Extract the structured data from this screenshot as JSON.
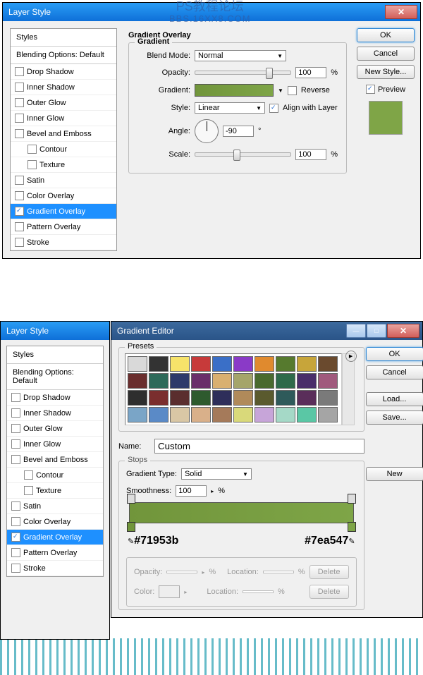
{
  "watermark": {
    "line1": "PS教程论坛",
    "line2": "BBS.16XX8.COM"
  },
  "dialog1": {
    "title": "Layer Style",
    "styles_header": "Styles",
    "blending_opts": "Blending Options: Default",
    "items": [
      {
        "label": "Drop Shadow",
        "checked": false,
        "indent": false
      },
      {
        "label": "Inner Shadow",
        "checked": false,
        "indent": false
      },
      {
        "label": "Outer Glow",
        "checked": false,
        "indent": false
      },
      {
        "label": "Inner Glow",
        "checked": false,
        "indent": false
      },
      {
        "label": "Bevel and Emboss",
        "checked": false,
        "indent": false
      },
      {
        "label": "Contour",
        "checked": false,
        "indent": true
      },
      {
        "label": "Texture",
        "checked": false,
        "indent": true
      },
      {
        "label": "Satin",
        "checked": false,
        "indent": false
      },
      {
        "label": "Color Overlay",
        "checked": false,
        "indent": false
      },
      {
        "label": "Gradient Overlay",
        "checked": true,
        "indent": false,
        "active": true
      },
      {
        "label": "Pattern Overlay",
        "checked": false,
        "indent": false
      },
      {
        "label": "Stroke",
        "checked": false,
        "indent": false
      }
    ],
    "center": {
      "heading": "Gradient Overlay",
      "group": "Gradient",
      "blend_mode_lbl": "Blend Mode:",
      "blend_mode_val": "Normal",
      "opacity_lbl": "Opacity:",
      "opacity_val": "100",
      "pct": "%",
      "gradient_lbl": "Gradient:",
      "reverse_lbl": "Reverse",
      "style_lbl": "Style:",
      "style_val": "Linear",
      "align_lbl": "Align with Layer",
      "angle_lbl": "Angle:",
      "angle_val": "-90",
      "deg": "°",
      "scale_lbl": "Scale:",
      "scale_val": "100"
    },
    "buttons": {
      "ok": "OK",
      "cancel": "Cancel",
      "new_style": "New Style...",
      "preview": "Preview"
    }
  },
  "dialog2": {
    "title": "Layer Style",
    "styles_header": "Styles",
    "blending_opts": "Blending Options: Default",
    "items": [
      {
        "label": "Drop Shadow",
        "checked": false
      },
      {
        "label": "Inner Shadow",
        "checked": false
      },
      {
        "label": "Outer Glow",
        "checked": false
      },
      {
        "label": "Inner Glow",
        "checked": false
      },
      {
        "label": "Bevel and Emboss",
        "checked": false
      },
      {
        "label": "Contour",
        "checked": false,
        "indent": true
      },
      {
        "label": "Texture",
        "checked": false,
        "indent": true
      },
      {
        "label": "Satin",
        "checked": false
      },
      {
        "label": "Color Overlay",
        "checked": false
      },
      {
        "label": "Gradient Overlay",
        "checked": true,
        "active": true
      },
      {
        "label": "Pattern Overlay",
        "checked": false
      },
      {
        "label": "Stroke",
        "checked": false
      }
    ]
  },
  "grad_editor": {
    "title": "Gradient Editor",
    "presets_lbl": "Presets",
    "swatches": [
      "#d9d9d9",
      "#333333",
      "#f7e36a",
      "#c73a3a",
      "#3a6fc7",
      "#8a3ac7",
      "#e08a2e",
      "#567a2e",
      "#c7a53a",
      "#6a4a2e",
      "#6a2e2e",
      "#2e6a5a",
      "#2e3a6a",
      "#6a2e6a",
      "#d9b070",
      "#a5a56a",
      "#4a6a2e",
      "#2e6a4a",
      "#4a2e6a",
      "#a05a7d",
      "#2e2e2e",
      "#7a2e2e",
      "#5a2e2e",
      "#2e5a2e",
      "#2e2e5a",
      "#b08a5a",
      "#5a5a2e",
      "#2e5a5a",
      "#5a2e5a",
      "#7a7a7a",
      "#7aa5c7",
      "#5a8ac7",
      "#d9c7a5",
      "#d9b08a",
      "#a57a5a",
      "#d9d97a",
      "#c7a5d9",
      "#a5d9c7",
      "#5ac7a5",
      "#a5a5a5"
    ],
    "name_lbl": "Name:",
    "name_val": "Custom",
    "type_lbl": "Gradient Type:",
    "type_val": "Solid",
    "smooth_lbl": "Smoothness:",
    "smooth_val": "100",
    "pct": "%",
    "hex_left": "#71953b",
    "hex_right": "#7ea547",
    "stops_lbl": "Stops",
    "opacity_lbl": "Opacity:",
    "location_lbl": "Location:",
    "color_lbl": "Color:",
    "buttons": {
      "ok": "OK",
      "cancel": "Cancel",
      "load": "Load...",
      "save": "Save...",
      "new": "New",
      "delete": "Delete"
    }
  }
}
